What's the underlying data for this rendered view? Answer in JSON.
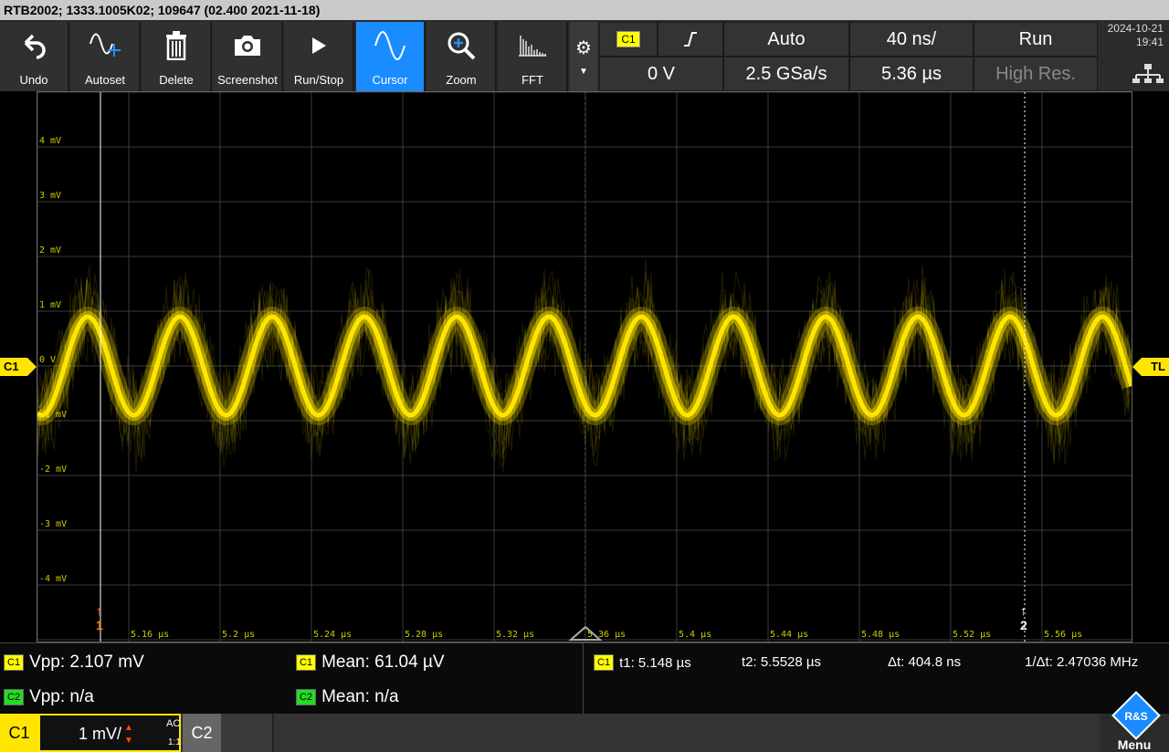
{
  "title": "RTB2002; 1333.1005K02; 109647 (02.400 2021-11-18)",
  "toolbar": {
    "buttons": [
      {
        "label": "Undo",
        "icon": "undo-icon"
      },
      {
        "label": "Autoset",
        "icon": "autoset-icon"
      },
      {
        "label": "Delete",
        "icon": "trash-icon"
      },
      {
        "label": "Screenshot",
        "icon": "camera-icon"
      },
      {
        "label": "Run/Stop",
        "icon": "play-icon"
      },
      {
        "label": "Cursor",
        "icon": "sine-icon"
      },
      {
        "label": "Zoom",
        "icon": "zoom-in-icon"
      },
      {
        "label": "FFT",
        "icon": "spectrum-icon"
      }
    ],
    "active": "Cursor"
  },
  "trigger": {
    "channel": "C1",
    "slope_icon": "rising-edge-icon",
    "level": "0 V",
    "mode": "Auto",
    "sample_rate": "2.5 GSa/s",
    "timebase": "40 ns/",
    "position": "5.36 µs",
    "run_state": "Run",
    "acq_mode": "High Res."
  },
  "datetime": {
    "date": "2024-10-21",
    "time": "19:41"
  },
  "plot": {
    "y_labels": [
      "4 mV",
      "3 mV",
      "2 mV",
      "1 mV",
      "0 V",
      "-1 mV",
      "-2 mV",
      "-3 mV",
      "-4 mV"
    ],
    "x_labels": [
      "5.16 µs",
      "5.2 µs",
      "5.24 µs",
      "5.28 µs",
      "5.32 µs",
      "5.36 µs",
      "5.4 µs",
      "5.44 µs",
      "5.48 µs",
      "5.52 µs",
      "5.56 µs"
    ],
    "left_marker": "C1",
    "right_marker": "TL",
    "cursor1_label": "1",
    "cursor2_label": "2",
    "trace_color": "#ffe600",
    "waveform": {
      "amplitude_mv": 0.9,
      "period_us": 0.0404,
      "center_mv": 0
    }
  },
  "measurements": {
    "c1_vpp": "Vpp: 2.107 mV",
    "c1_mean": "Mean: 61.04 µV",
    "c2_vpp": "Vpp: n/a",
    "c2_mean": "Mean: n/a",
    "cursor_channel": "C1",
    "t1": "t1: 5.148 µs",
    "t2": "t2: 5.5528 µs",
    "dt": "Δt: 404.8 ns",
    "inv_dt": "1/Δt: 2.47036 MHz",
    "c1_badge": "C1",
    "c2_badge": "C2"
  },
  "channels": {
    "c1_label": "C1",
    "c1_scale": "1 mV/",
    "c1_coupling": "AC",
    "c1_probe": "1:1",
    "c2_label": "C2"
  },
  "menu": {
    "label": "Menu",
    "logo": "R&S"
  }
}
